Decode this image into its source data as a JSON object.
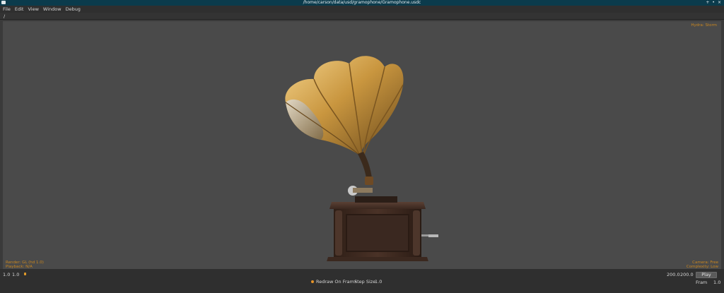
{
  "window": {
    "title": "/home/carson/data/usd/gramophone/Gramophone.usdc",
    "controls": [
      "+",
      "•",
      "×"
    ]
  },
  "menu": [
    "File",
    "Edit",
    "View",
    "Window",
    "Debug"
  ],
  "path": "/",
  "viewport": {
    "hud_top_right": "Hydra: Storm",
    "hud_bottom_left": [
      "Render: GL (hd 1.0)",
      "Playback: N/A"
    ],
    "hud_bottom_right": [
      "Camera: Free",
      "Complexity: Low"
    ]
  },
  "timeline": {
    "start_frame": "1.0",
    "current_start": "1.0",
    "end_current": "200.0",
    "end_frame": "200.0",
    "redraw_label": "Redraw On Fram•",
    "step_label": "Step Size",
    "step_value": "1.0",
    "play_label": "Play",
    "frame_label": "Fram",
    "frame_value": "1.0"
  }
}
